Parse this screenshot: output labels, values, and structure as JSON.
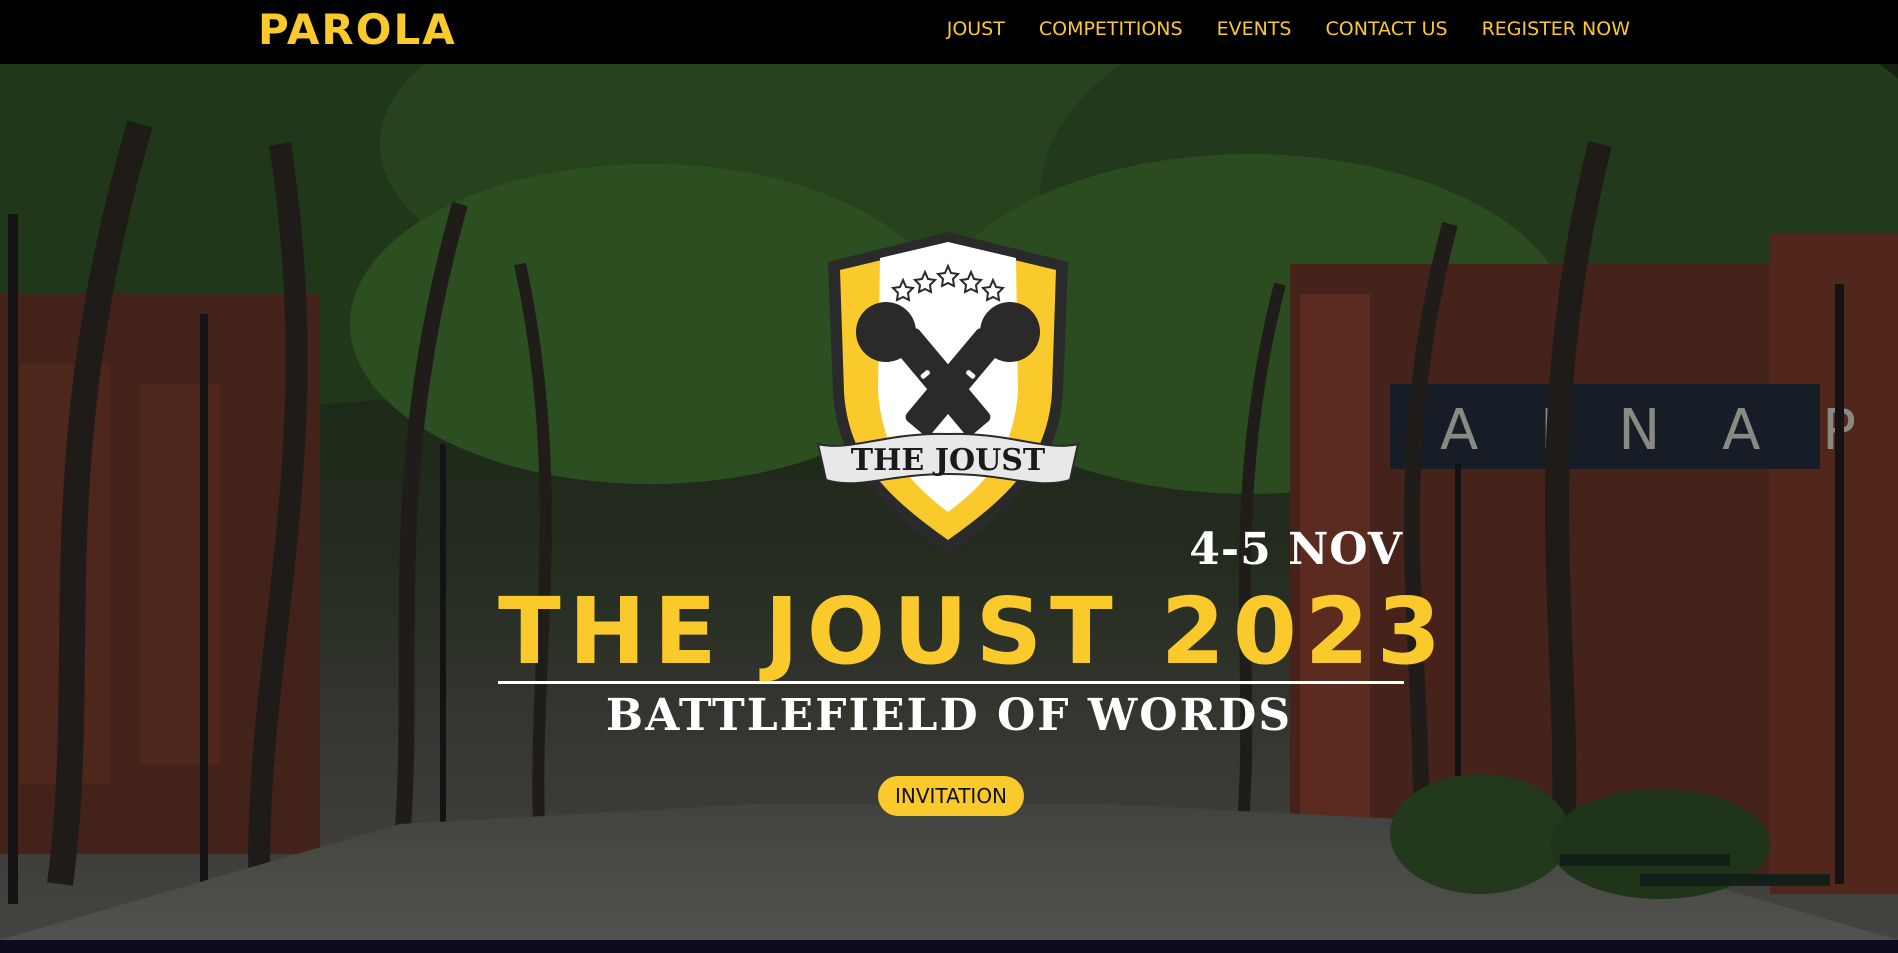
{
  "navbar": {
    "brand": "PAROLA",
    "links": [
      "JOUST",
      "COMPETITIONS",
      "EVENTS",
      "CONTACT US",
      "REGISTER NOW"
    ]
  },
  "hero": {
    "crest_banner": "THE JOUST",
    "date": "4-5 NOV",
    "title": "THE JOUST 2023",
    "subtitle": "BATTLEFIELD OF WORDS",
    "button": "INVITATION",
    "background_sign": "A I N A P"
  },
  "colors": {
    "accent": "#fac92c",
    "navbar_bg": "#000000",
    "text_light": "#ffffff"
  },
  "icons": [
    "crest-icon",
    "microphone-icon",
    "star-icon"
  ]
}
